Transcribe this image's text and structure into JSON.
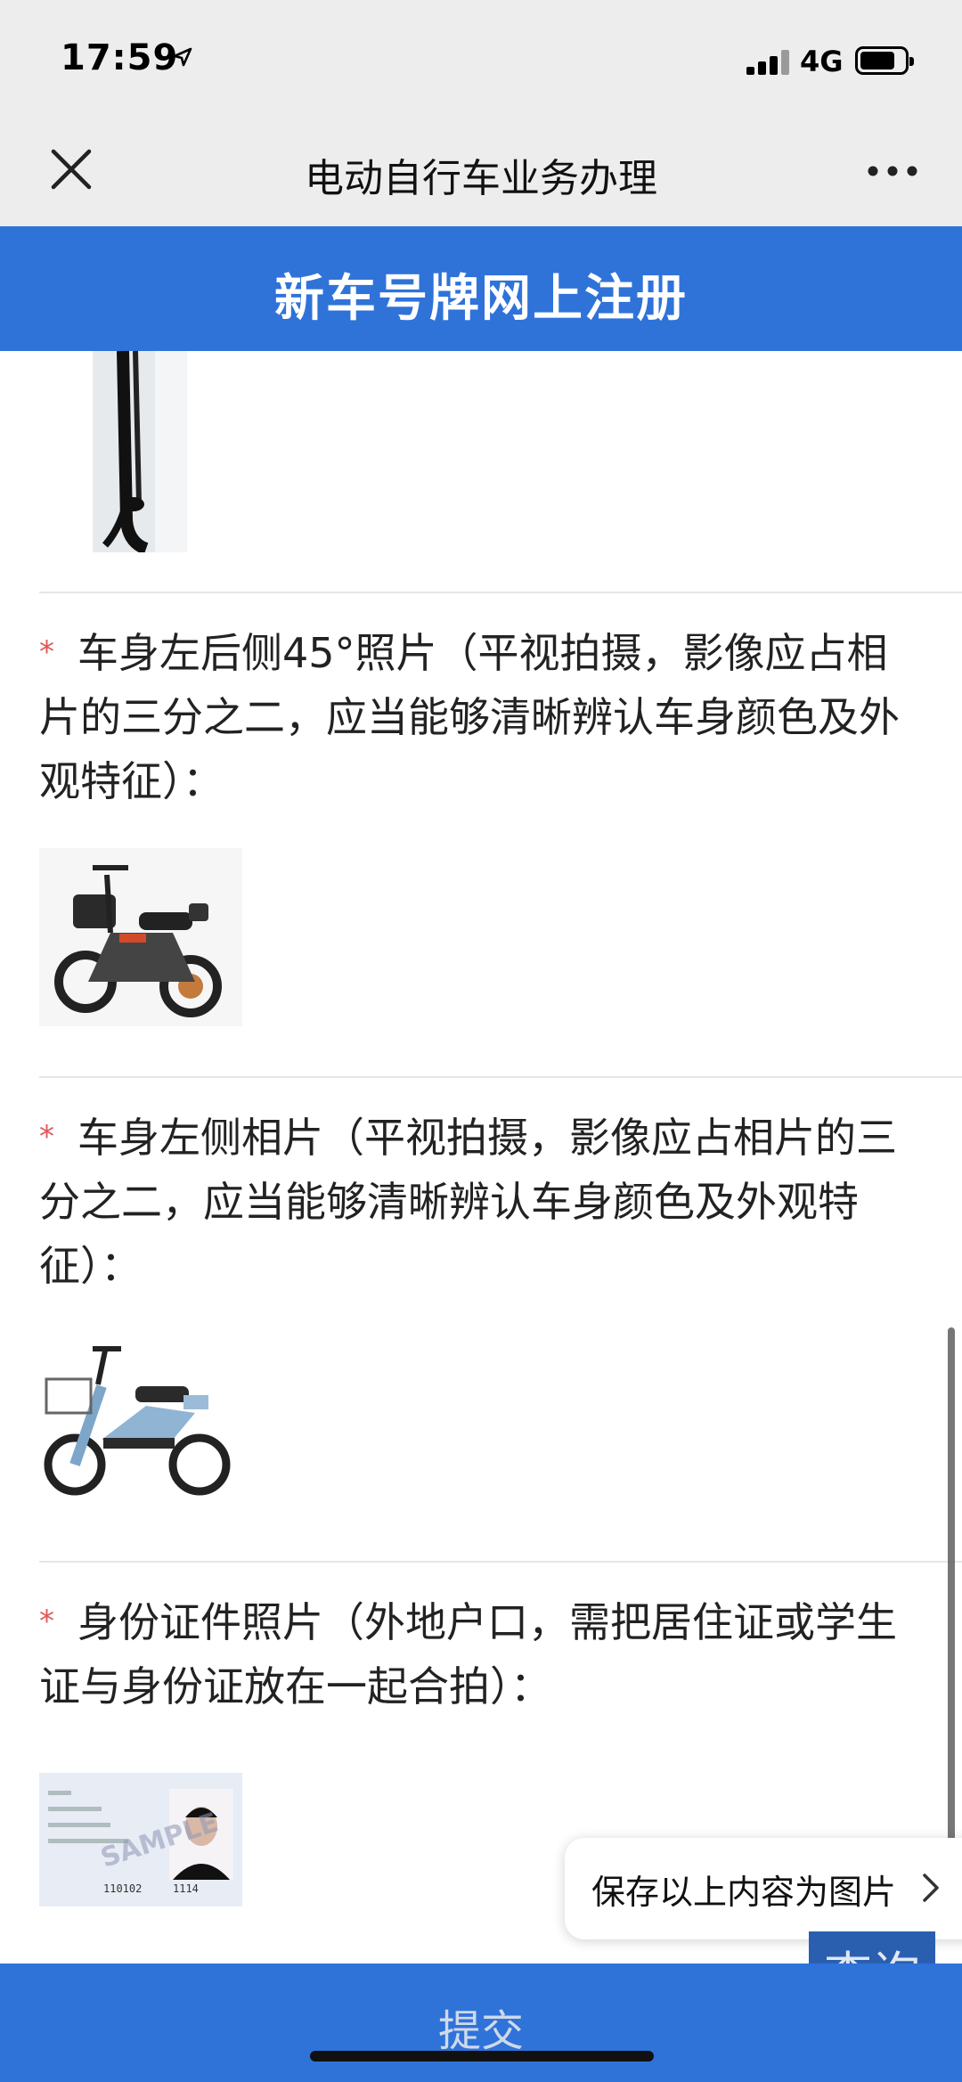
{
  "status_bar": {
    "time": "17:59",
    "network": "4G"
  },
  "nav": {
    "title": "电动自行车业务办理"
  },
  "header": {
    "title": "新车号牌网上注册"
  },
  "fields": [
    {
      "required_mark": "*",
      "label": "车身左后侧45°照片（平视拍摄，影像应占相片的三分之二，应当能够清晰辨认车身颜色及外观特征）："
    },
    {
      "required_mark": "*",
      "label": "车身左侧相片（平视拍摄，影像应占相片的三分之二，应当能够清晰辨认车身颜色及外观特征）："
    },
    {
      "required_mark": "*",
      "label": "身份证件照片（外地户口，需把居住证或学生证与身份证放在一起合拍）："
    }
  ],
  "id_card": {
    "watermark": "SAMPLE",
    "number_left": "110102",
    "number_right": "1114"
  },
  "floating": {
    "save_label": "保存以上内容为图片",
    "query_label": "查询"
  },
  "footer": {
    "submit_label": "提交"
  },
  "icons": {
    "close": "close-icon",
    "more": "more-icon",
    "location": "location-arrow-icon",
    "signal": "signal-icon",
    "battery": "battery-icon",
    "chevron": "chevron-right-icon"
  },
  "colors": {
    "brand_blue": "#2f73d9",
    "required_red": "#e0575b",
    "query_blue": "#2a5fb0"
  }
}
